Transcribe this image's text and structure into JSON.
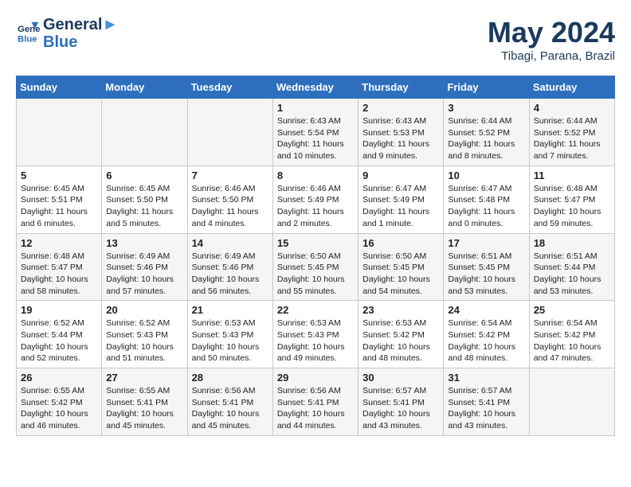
{
  "header": {
    "logo_line1": "General",
    "logo_line2": "Blue",
    "month": "May 2024",
    "location": "Tibagi, Parana, Brazil"
  },
  "weekdays": [
    "Sunday",
    "Monday",
    "Tuesday",
    "Wednesday",
    "Thursday",
    "Friday",
    "Saturday"
  ],
  "weeks": [
    [
      {
        "day": "",
        "info": ""
      },
      {
        "day": "",
        "info": ""
      },
      {
        "day": "",
        "info": ""
      },
      {
        "day": "1",
        "info": "Sunrise: 6:43 AM\nSunset: 5:54 PM\nDaylight: 11 hours and 10 minutes."
      },
      {
        "day": "2",
        "info": "Sunrise: 6:43 AM\nSunset: 5:53 PM\nDaylight: 11 hours and 9 minutes."
      },
      {
        "day": "3",
        "info": "Sunrise: 6:44 AM\nSunset: 5:52 PM\nDaylight: 11 hours and 8 minutes."
      },
      {
        "day": "4",
        "info": "Sunrise: 6:44 AM\nSunset: 5:52 PM\nDaylight: 11 hours and 7 minutes."
      }
    ],
    [
      {
        "day": "5",
        "info": "Sunrise: 6:45 AM\nSunset: 5:51 PM\nDaylight: 11 hours and 6 minutes."
      },
      {
        "day": "6",
        "info": "Sunrise: 6:45 AM\nSunset: 5:50 PM\nDaylight: 11 hours and 5 minutes."
      },
      {
        "day": "7",
        "info": "Sunrise: 6:46 AM\nSunset: 5:50 PM\nDaylight: 11 hours and 4 minutes."
      },
      {
        "day": "8",
        "info": "Sunrise: 6:46 AM\nSunset: 5:49 PM\nDaylight: 11 hours and 2 minutes."
      },
      {
        "day": "9",
        "info": "Sunrise: 6:47 AM\nSunset: 5:49 PM\nDaylight: 11 hours and 1 minute."
      },
      {
        "day": "10",
        "info": "Sunrise: 6:47 AM\nSunset: 5:48 PM\nDaylight: 11 hours and 0 minutes."
      },
      {
        "day": "11",
        "info": "Sunrise: 6:48 AM\nSunset: 5:47 PM\nDaylight: 10 hours and 59 minutes."
      }
    ],
    [
      {
        "day": "12",
        "info": "Sunrise: 6:48 AM\nSunset: 5:47 PM\nDaylight: 10 hours and 58 minutes."
      },
      {
        "day": "13",
        "info": "Sunrise: 6:49 AM\nSunset: 5:46 PM\nDaylight: 10 hours and 57 minutes."
      },
      {
        "day": "14",
        "info": "Sunrise: 6:49 AM\nSunset: 5:46 PM\nDaylight: 10 hours and 56 minutes."
      },
      {
        "day": "15",
        "info": "Sunrise: 6:50 AM\nSunset: 5:45 PM\nDaylight: 10 hours and 55 minutes."
      },
      {
        "day": "16",
        "info": "Sunrise: 6:50 AM\nSunset: 5:45 PM\nDaylight: 10 hours and 54 minutes."
      },
      {
        "day": "17",
        "info": "Sunrise: 6:51 AM\nSunset: 5:45 PM\nDaylight: 10 hours and 53 minutes."
      },
      {
        "day": "18",
        "info": "Sunrise: 6:51 AM\nSunset: 5:44 PM\nDaylight: 10 hours and 53 minutes."
      }
    ],
    [
      {
        "day": "19",
        "info": "Sunrise: 6:52 AM\nSunset: 5:44 PM\nDaylight: 10 hours and 52 minutes."
      },
      {
        "day": "20",
        "info": "Sunrise: 6:52 AM\nSunset: 5:43 PM\nDaylight: 10 hours and 51 minutes."
      },
      {
        "day": "21",
        "info": "Sunrise: 6:53 AM\nSunset: 5:43 PM\nDaylight: 10 hours and 50 minutes."
      },
      {
        "day": "22",
        "info": "Sunrise: 6:53 AM\nSunset: 5:43 PM\nDaylight: 10 hours and 49 minutes."
      },
      {
        "day": "23",
        "info": "Sunrise: 6:53 AM\nSunset: 5:42 PM\nDaylight: 10 hours and 48 minutes."
      },
      {
        "day": "24",
        "info": "Sunrise: 6:54 AM\nSunset: 5:42 PM\nDaylight: 10 hours and 48 minutes."
      },
      {
        "day": "25",
        "info": "Sunrise: 6:54 AM\nSunset: 5:42 PM\nDaylight: 10 hours and 47 minutes."
      }
    ],
    [
      {
        "day": "26",
        "info": "Sunrise: 6:55 AM\nSunset: 5:42 PM\nDaylight: 10 hours and 46 minutes."
      },
      {
        "day": "27",
        "info": "Sunrise: 6:55 AM\nSunset: 5:41 PM\nDaylight: 10 hours and 45 minutes."
      },
      {
        "day": "28",
        "info": "Sunrise: 6:56 AM\nSunset: 5:41 PM\nDaylight: 10 hours and 45 minutes."
      },
      {
        "day": "29",
        "info": "Sunrise: 6:56 AM\nSunset: 5:41 PM\nDaylight: 10 hours and 44 minutes."
      },
      {
        "day": "30",
        "info": "Sunrise: 6:57 AM\nSunset: 5:41 PM\nDaylight: 10 hours and 43 minutes."
      },
      {
        "day": "31",
        "info": "Sunrise: 6:57 AM\nSunset: 5:41 PM\nDaylight: 10 hours and 43 minutes."
      },
      {
        "day": "",
        "info": ""
      }
    ]
  ]
}
